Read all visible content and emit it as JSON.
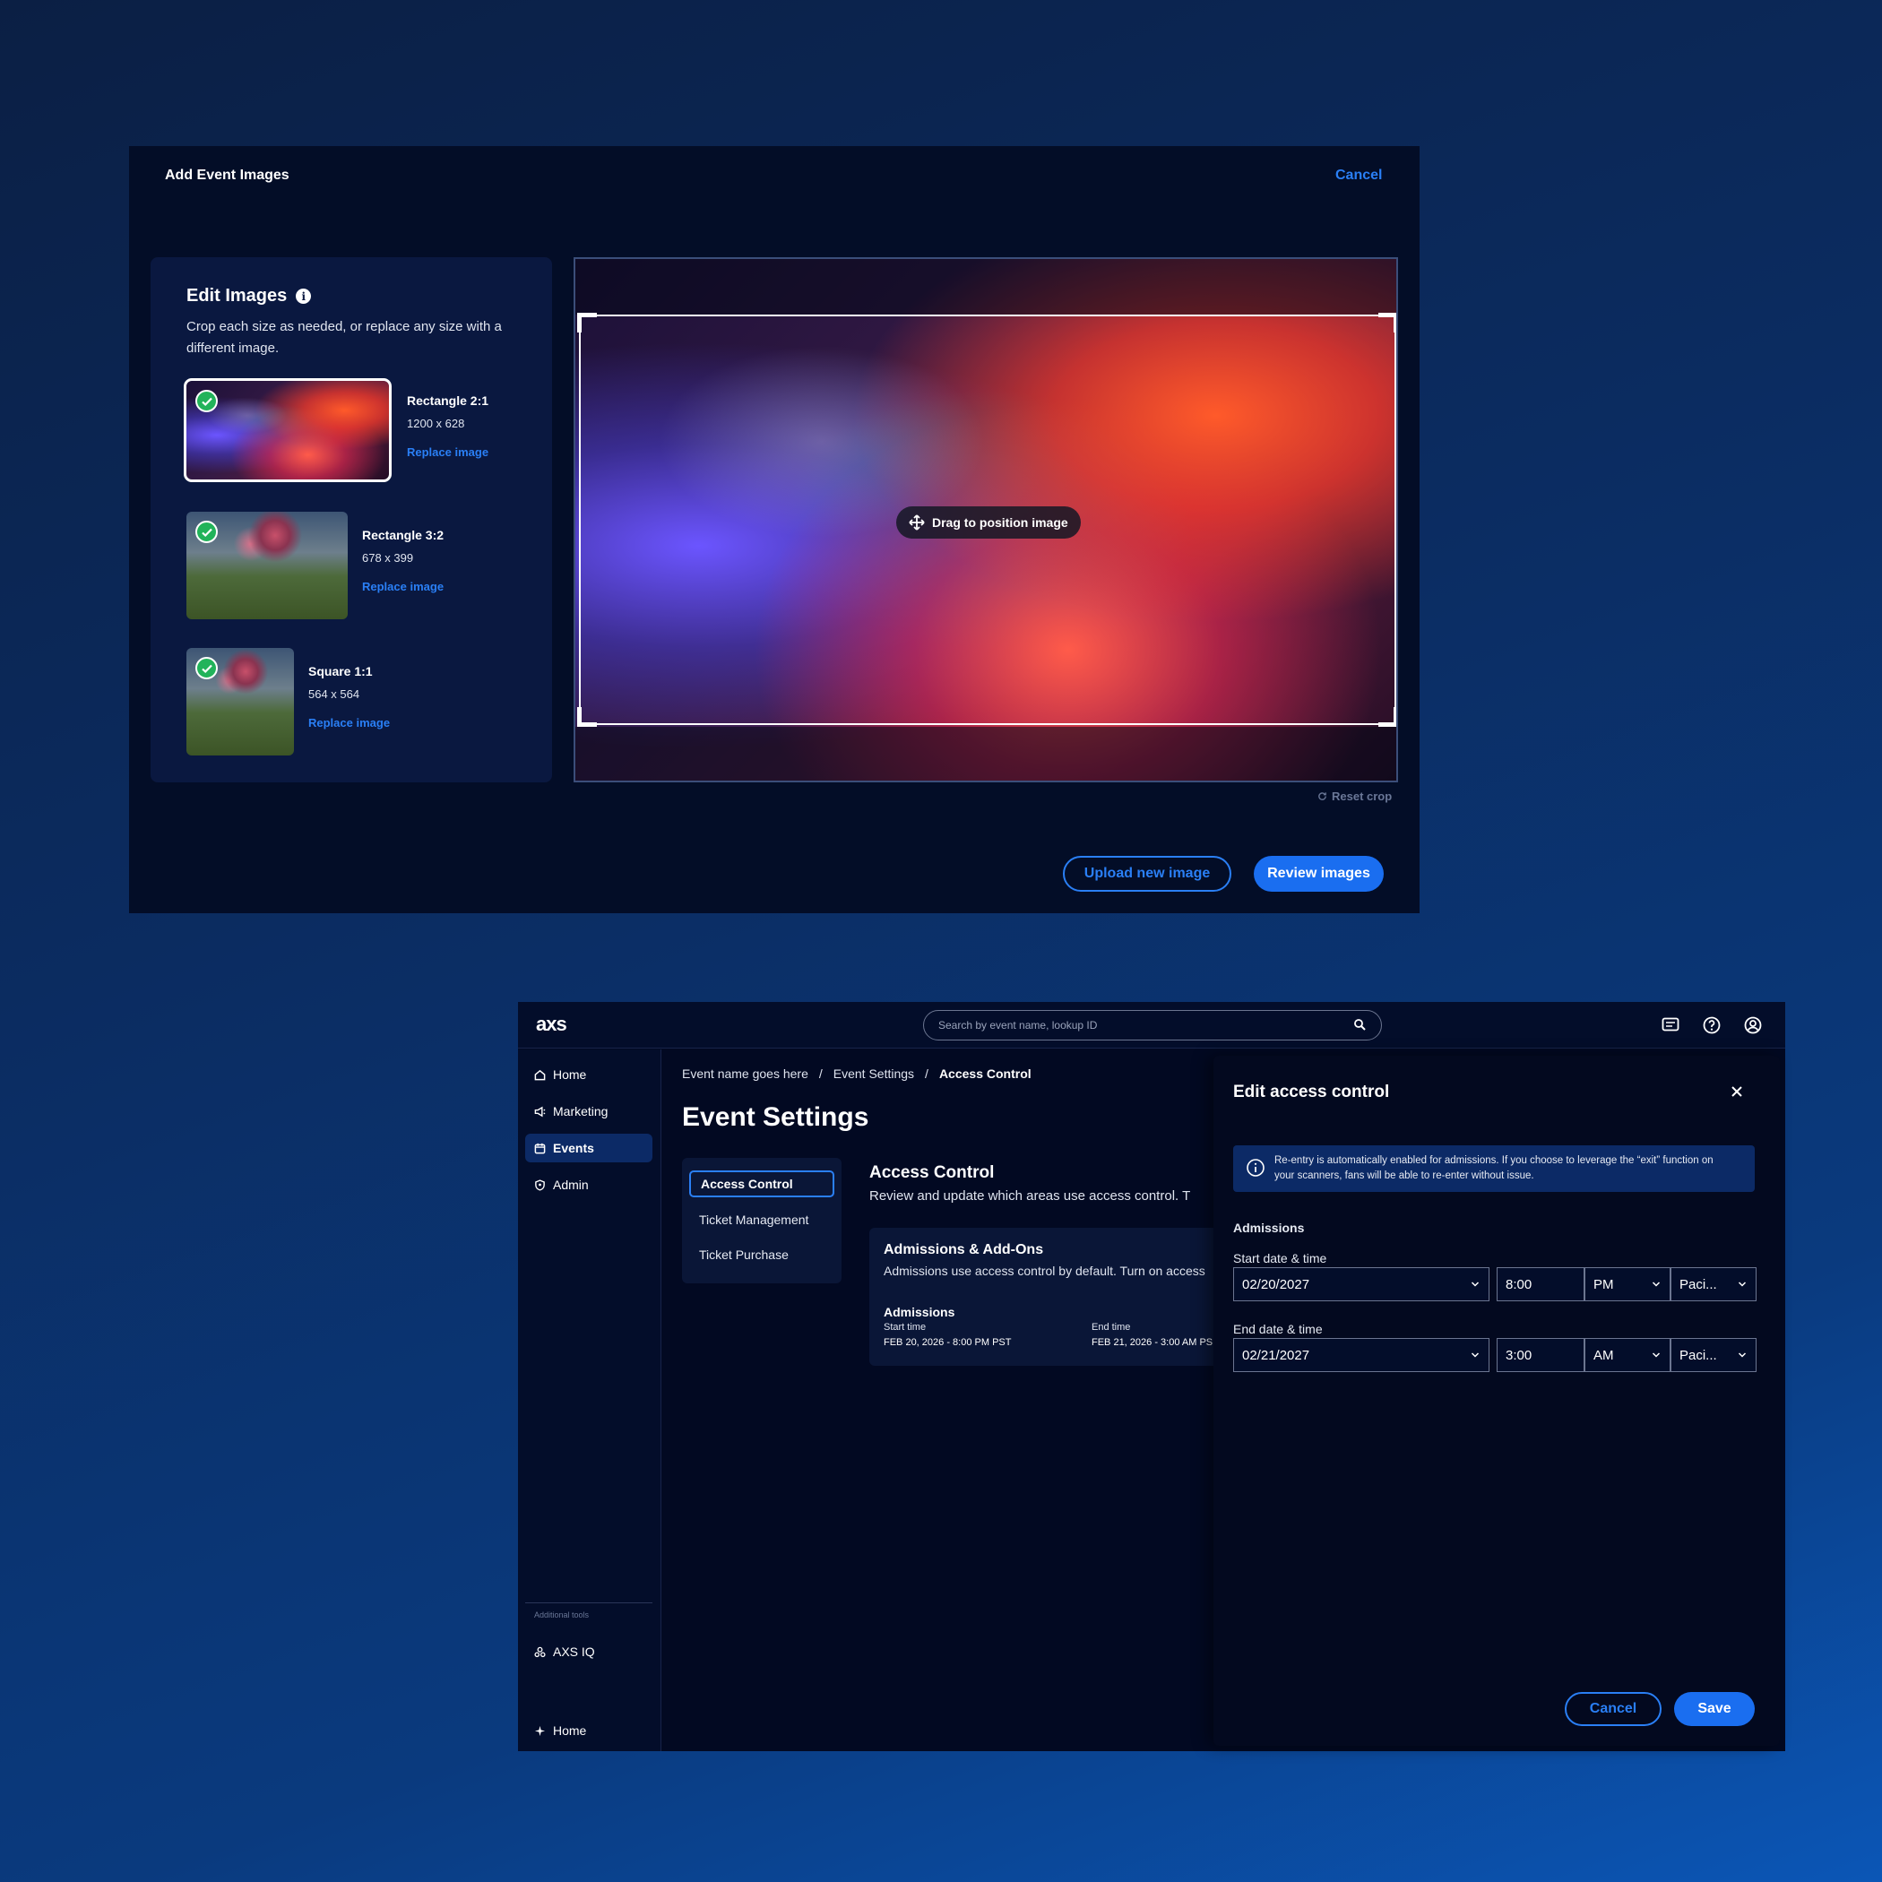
{
  "image_editor": {
    "title": "Add Event Images",
    "cancel_label": "Cancel",
    "edit_heading": "Edit Images",
    "edit_description": "Crop each size as needed, or replace any size with a different image.",
    "sizes": [
      {
        "name": "Rectangle 2:1",
        "dimensions": "1200 x 628",
        "action": "Replace image",
        "selected": true
      },
      {
        "name": "Rectangle 3:2",
        "dimensions": "678 x 399",
        "action": "Replace image",
        "selected": false
      },
      {
        "name": "Square 1:1",
        "dimensions": "564 x 564",
        "action": "Replace image",
        "selected": false
      }
    ],
    "drag_hint": "Drag to position image",
    "reset_label": "Reset crop",
    "upload_label": "Upload new image",
    "review_label": "Review images"
  },
  "app": {
    "logo": "axs",
    "search_placeholder": "Search by event name, lookup ID",
    "sidebar": {
      "items": [
        {
          "label": "Home",
          "icon": "home-icon",
          "active": false
        },
        {
          "label": "Marketing",
          "icon": "megaphone-icon",
          "active": false
        },
        {
          "label": "Events",
          "icon": "calendar-icon",
          "active": true
        },
        {
          "label": "Admin",
          "icon": "shield-icon",
          "active": false
        }
      ],
      "additional_tools_label": "Additional tools",
      "tools": [
        {
          "label": "AXS IQ",
          "icon": "axs-iq-icon"
        }
      ],
      "footer_item": {
        "label": "Home",
        "icon": "sparkle-icon"
      }
    },
    "breadcrumb": [
      "Event name goes here",
      "Event Settings",
      "Access Control"
    ],
    "page_title": "Event Settings",
    "subnav": [
      "Access Control",
      "Ticket Management",
      "Ticket Purchase"
    ],
    "section": {
      "title": "Access Control",
      "description": "Review and update which areas use access control. T",
      "card": {
        "title": "Admissions & Add-Ons",
        "description": "Admissions use access control by default. Turn on access",
        "sub_title": "Admissions",
        "start_label": "Start time",
        "start_value": "FEB 20, 2026 - 8:00 PM PST",
        "end_label": "End time",
        "end_value": "FEB 21, 2026 - 3:00 AM PS"
      }
    },
    "drawer": {
      "title": "Edit access control",
      "info": "Re-entry is automatically enabled for admissions. If you choose to leverage the “exit” function on your scanners, fans will be able to re-enter without issue.",
      "section_label": "Admissions",
      "start_label": "Start date & time",
      "start": {
        "date": "02/20/2027",
        "time": "8:00",
        "ampm": "PM",
        "tz": "Paci..."
      },
      "end_label": "End date & time",
      "end": {
        "date": "02/21/2027",
        "time": "3:00",
        "ampm": "AM",
        "tz": "Paci..."
      },
      "cancel_label": "Cancel",
      "save_label": "Save"
    }
  },
  "colors": {
    "accent": "#2a7ff5",
    "panel": "#030d27",
    "success": "#22b35a"
  }
}
